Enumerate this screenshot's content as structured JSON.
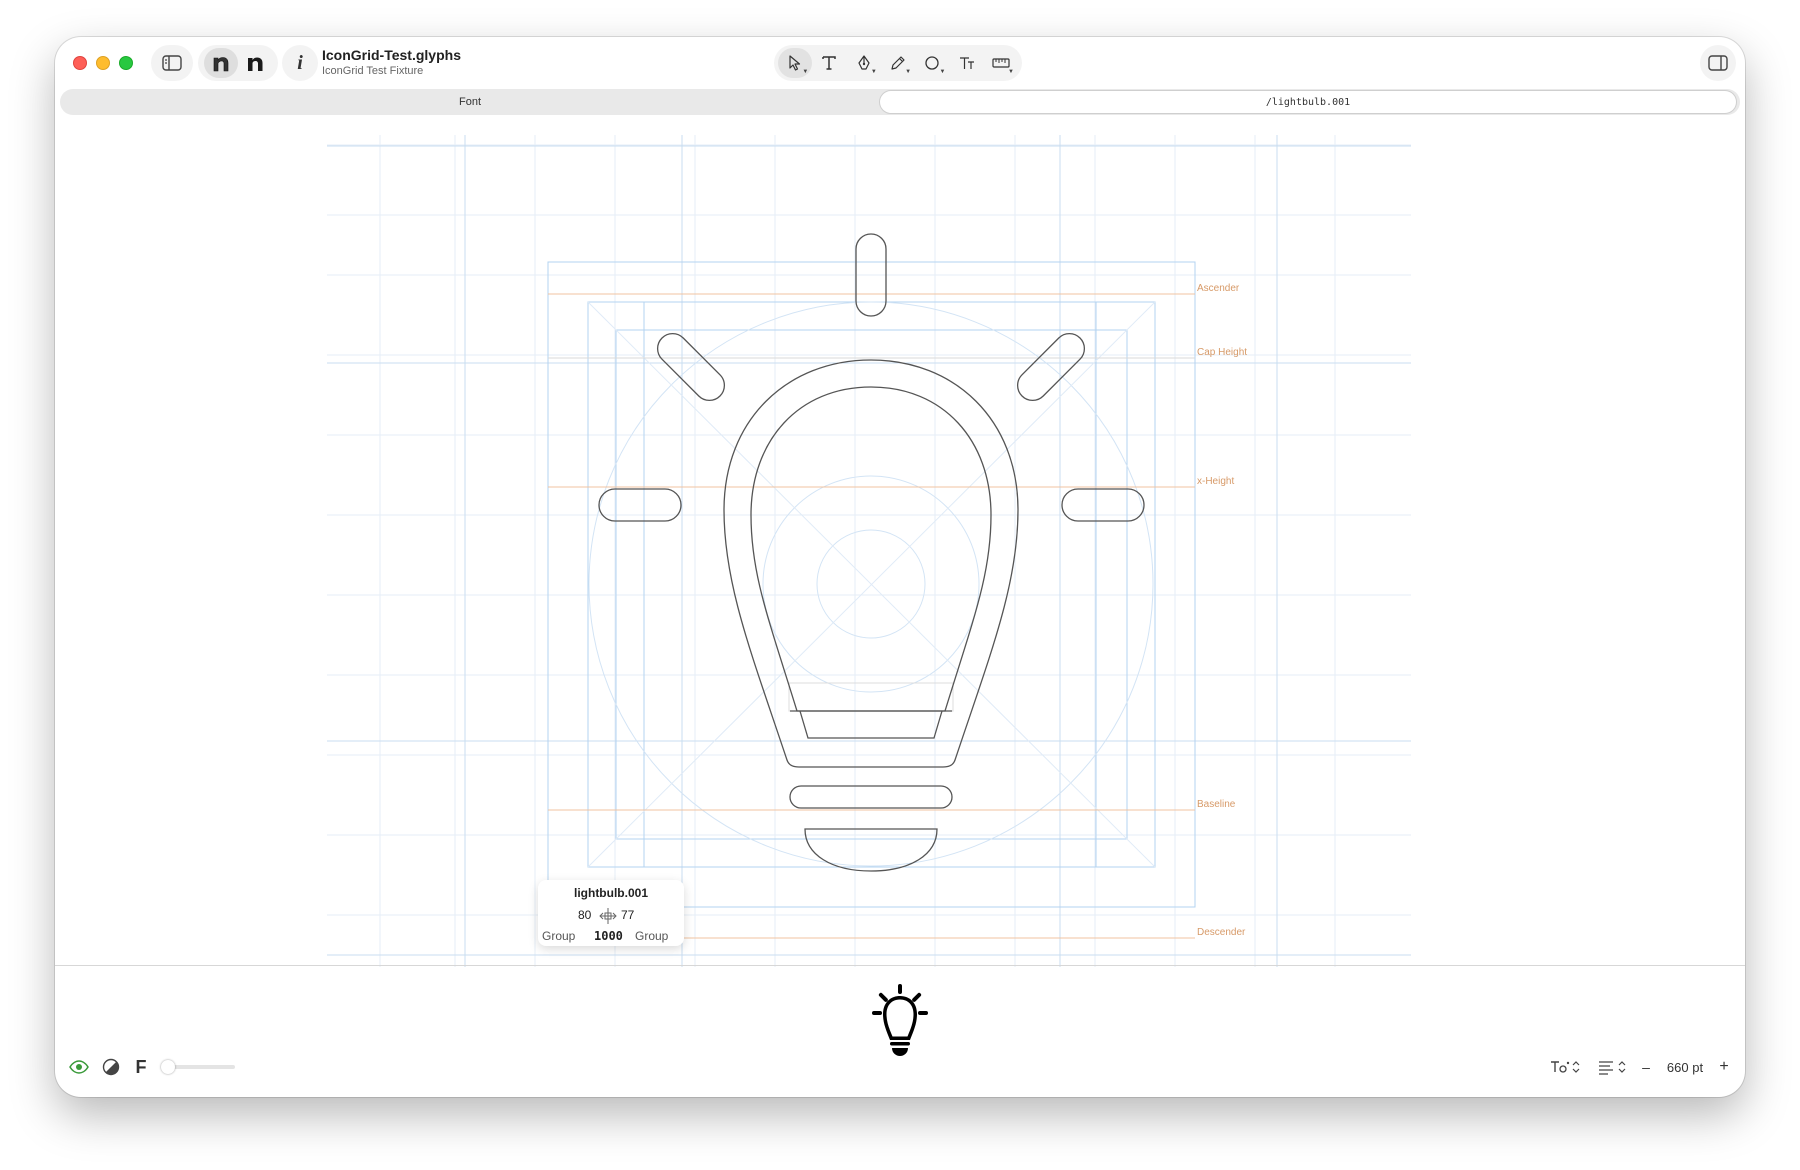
{
  "toolbar": {
    "title": "IconGrid-Test.glyphs",
    "subtitle": "IconGrid Test Fixture",
    "info_label": "i"
  },
  "tabs": {
    "font": "Font",
    "glyph": "/lightbulb.001"
  },
  "metrics": {
    "ascender": "Ascender",
    "cap_height": "Cap Height",
    "x_height": "x-Height",
    "baseline": "Baseline",
    "descender": "Descender"
  },
  "info": {
    "name": "lightbulb.001",
    "lsb": "80",
    "rsb": "77",
    "left_group": "Group",
    "width": "1000",
    "right_group": "Group"
  },
  "statusbar": {
    "font_label": "F",
    "zoom": "660 pt",
    "minus": "–",
    "plus": "+"
  },
  "colors": {
    "grid": "#dbe8f5",
    "guide": "#a7cdef",
    "metric": "#f0c3a0",
    "outline": "#555555"
  }
}
